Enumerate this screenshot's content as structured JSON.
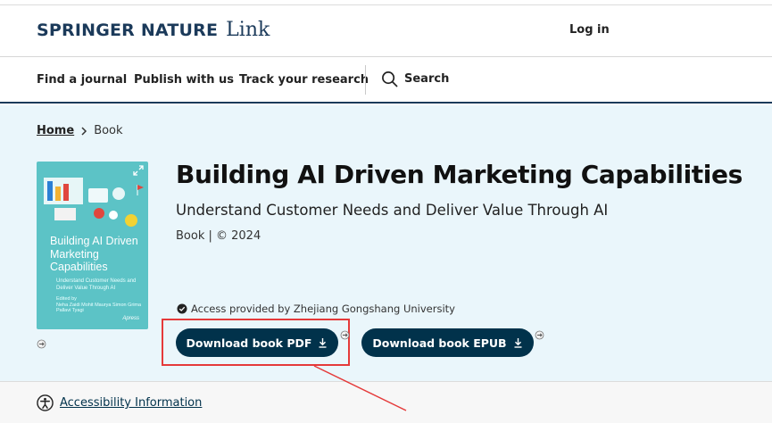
{
  "header": {
    "logo_mark": "SPRINGER NATURE",
    "logo_link": "Link",
    "login_label": "Log in"
  },
  "nav": {
    "items": [
      "Find a journal",
      "Publish with us",
      "Track your research"
    ],
    "search_label": "Search"
  },
  "breadcrumb": {
    "home": "Home",
    "current": "Book"
  },
  "book": {
    "title": "Building AI Driven Marketing Capabilities",
    "subtitle": "Understand Customer Needs and Deliver Value Through AI",
    "meta": "Book | © 2024",
    "access_text": "Access provided by Zhejiang Gongshang University"
  },
  "cover": {
    "title": "Building AI Driven Marketing Capabilities",
    "subtitle": "Understand Customer Needs and Deliver Value Through AI",
    "editors_label": "Edited by",
    "editors": "Neha Zaidi   Mohit Maurya   Simon Grima   Pallavi Tyagi",
    "publisher": "Apress",
    "background_color": "#5cc3c6"
  },
  "actions": {
    "download_pdf": "Download book PDF",
    "download_epub": "Download book EPUB",
    "button_color": "#01324b",
    "highlight_color": "#e53a3a"
  },
  "footer": {
    "accessibility_label": "Accessibility Information"
  }
}
